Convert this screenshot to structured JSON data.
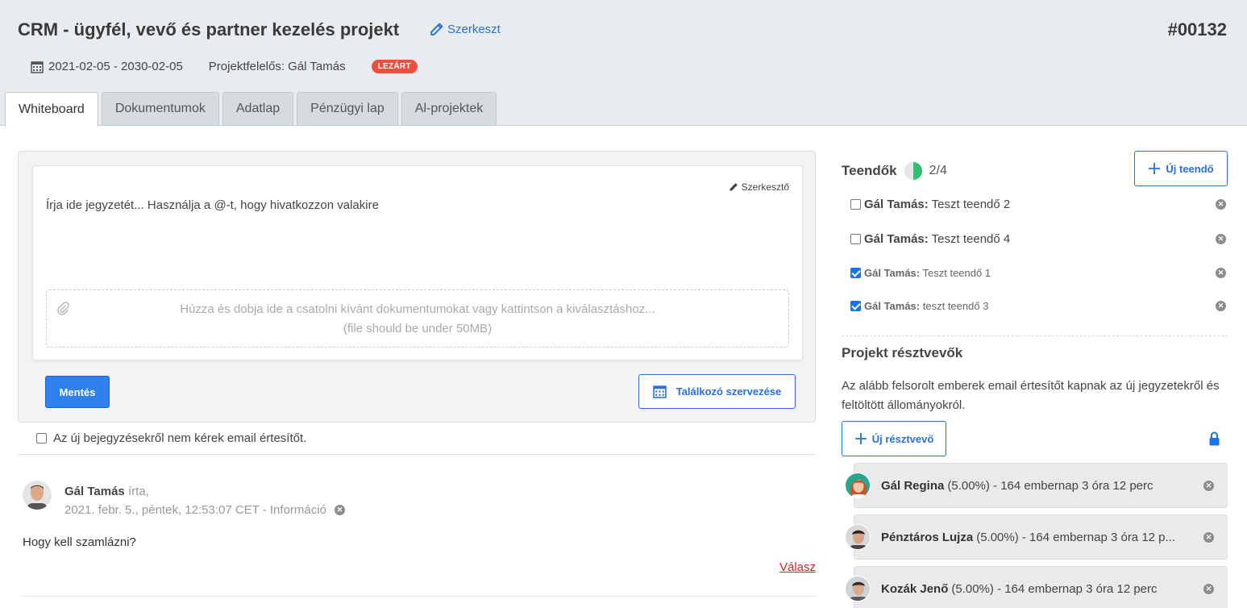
{
  "header": {
    "title": "CRM - ügyfél, vevő és partner kezelés projekt",
    "edit_label": "Szerkeszt",
    "project_id": "#00132",
    "date_range": "2021-02-05 - 2030-02-05",
    "owner": "Projektfelelős: Gál Tamás",
    "status_badge": "LEZÁRT",
    "badge_color": "#f04e3e"
  },
  "tabs": [
    {
      "label": "Whiteboard",
      "active": true
    },
    {
      "label": "Dokumentumok"
    },
    {
      "label": "Adatlap"
    },
    {
      "label": "Pénzügyi lap"
    },
    {
      "label": "Al-projektek"
    }
  ],
  "editor": {
    "editor_button": "Szerkesztő",
    "placeholder": "Írja ide jegyzetét... Használja a @-t, hogy hivatkozzon valakire",
    "dropzone_line1": "Húzza és dobja ide a csatolni kívánt dokumentumokat vagy kattintson a kiválasztáshoz...",
    "dropzone_line2": "(file should be under 50MB)",
    "save_label": "Mentés",
    "meeting_label": "Találkozó szervezése"
  },
  "email_optout": "Az új bejegyzésekről nem kérek email értesítőt.",
  "post": {
    "author": "Gál Tamás",
    "wrote": "írta,",
    "meta": "2021. febr. 5., péntek, 12:53:07 CET - Információ",
    "text": "Hogy kell szamlázni?",
    "reply_label": "Válasz"
  },
  "todos": {
    "title": "Teendők",
    "count": "2/4",
    "progress": 0.5,
    "new_label": "Új teendő",
    "items": [
      {
        "assignee": "Gál Tamás:",
        "task": "Teszt teendő 2",
        "done": false
      },
      {
        "assignee": "Gál Tamás:",
        "task": "Teszt teendő 4",
        "done": false
      },
      {
        "assignee": "Gál Tamás:",
        "task": "Teszt teendő 1",
        "done": true
      },
      {
        "assignee": "Gál Tamás:",
        "task": "teszt teendő 3",
        "done": true
      }
    ]
  },
  "participants": {
    "title": "Projekt résztvevők",
    "description": "Az alább felsorolt emberek email értesítőt kapnak az új jegyzetekről és feltöltött állományokról.",
    "new_label": "Új résztvevő",
    "items": [
      {
        "name": "Gál Regina",
        "details": "(5.00%) - 164 embernap 3 óra 12 perc"
      },
      {
        "name": "Pénztáros Lujza",
        "details": "(5.00%) - 164 embernap 3 óra 12 p..."
      },
      {
        "name": "Kozák Jenő",
        "details": "(5.00%) - 164 embernap 3 óra 12 perc"
      }
    ]
  },
  "colors": {
    "accent": "#2a6fdb",
    "primary_button": "#2f80ed",
    "reply_link": "#d9232d",
    "progress_fill": "#2fbf71"
  }
}
